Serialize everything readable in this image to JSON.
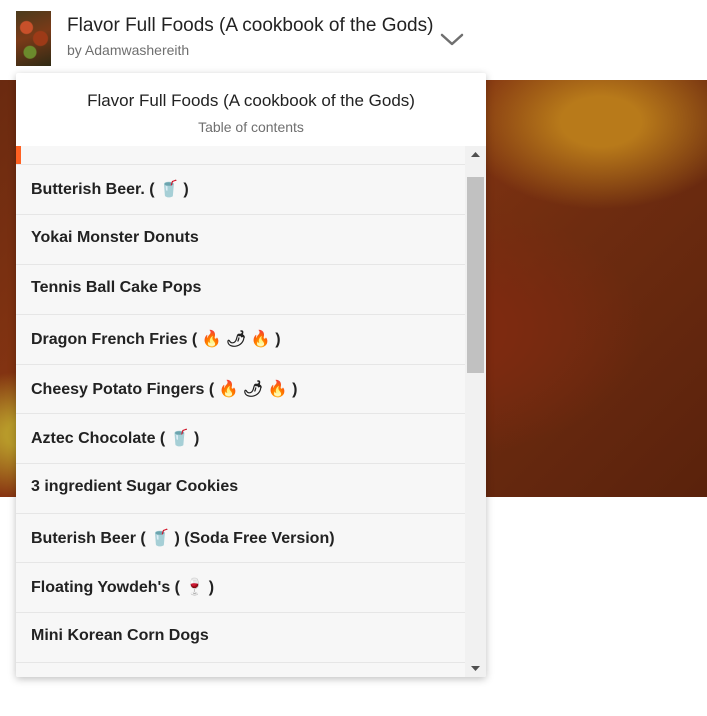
{
  "header": {
    "title": "Flavor Full Foods (A cookbook of the Gods)",
    "author": "by Adamwashereith",
    "toggle_icon": "chevron-down-icon"
  },
  "toc": {
    "title": "Flavor Full Foods (A cookbook of the Gods)",
    "subtitle": "Table of contents",
    "accent_color": "#ff6122",
    "items": [
      {
        "label": "Butterish Beer. ( 🥤 )"
      },
      {
        "label": "Yokai Monster Donuts"
      },
      {
        "label": "Tennis Ball Cake Pops"
      },
      {
        "label": "Dragon French Fries ( 🔥 🌶 🔥 )"
      },
      {
        "label": "Cheesy Potato Fingers ( 🔥 🌶 🔥 )"
      },
      {
        "label": "Aztec Chocolate ( 🥤 )"
      },
      {
        "label": "3 ingredient Sugar Cookies"
      },
      {
        "label": "Buterish Beer ( 🥤 ) (Soda Free Version)"
      },
      {
        "label": "Floating Yowdeh's ( 🍷 )"
      },
      {
        "label": "Mini Korean Corn Dogs"
      }
    ]
  }
}
